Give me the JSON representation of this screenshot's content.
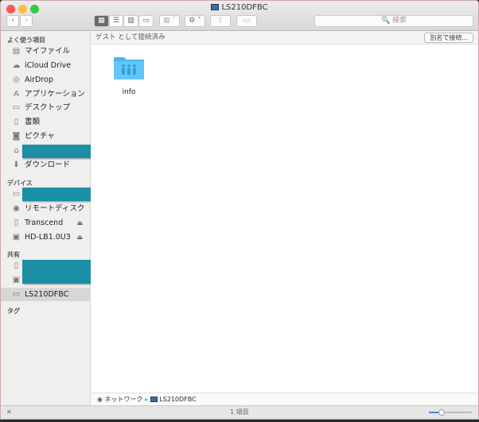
{
  "window": {
    "title": "LS210DFBC"
  },
  "toolbar": {
    "back": "‹",
    "forward": "›",
    "search_placeholder": "🔍 検索"
  },
  "sidebar": {
    "favorites_label": "よく使う項目",
    "favorites": [
      {
        "label": "マイファイル",
        "icon": "all-files-icon"
      },
      {
        "label": "iCloud Drive",
        "icon": "cloud-icon"
      },
      {
        "label": "AirDrop",
        "icon": "airdrop-icon"
      },
      {
        "label": "アプリケーション",
        "icon": "applications-icon"
      },
      {
        "label": "デスクトップ",
        "icon": "desktop-icon"
      },
      {
        "label": "書類",
        "icon": "documents-icon"
      },
      {
        "label": "ピクチャ",
        "icon": "camera-icon"
      },
      {
        "label": "",
        "icon": "home-icon"
      },
      {
        "label": "ダウンロード",
        "icon": "download-icon"
      }
    ],
    "devices_label": "デバイス",
    "devices": [
      {
        "label": "",
        "icon": "laptop-icon"
      },
      {
        "label": "リモートディスク",
        "icon": "disc-icon"
      },
      {
        "label": "Transcend",
        "icon": "drive-icon",
        "eject": "⏏"
      },
      {
        "label": "HD-LB1.0U3",
        "icon": "drive-icon",
        "eject": "⏏"
      }
    ],
    "shared_label": "共有",
    "shared": [
      {
        "label": "",
        "icon": "phone-icon"
      },
      {
        "label": "",
        "icon": "monitor-icon"
      },
      {
        "label": "LS210DFBC",
        "icon": "monitor-icon"
      }
    ],
    "tags_label": "タグ"
  },
  "main": {
    "connection_status": "ゲスト として接続済み",
    "connect_as_button": "別名で接続...",
    "items": [
      {
        "name": "info"
      }
    ]
  },
  "pathbar": {
    "network": "ネットワーク",
    "separator": "▸",
    "server": "LS210DFBC"
  },
  "statusbar": {
    "count": "1 項目",
    "close": "✕",
    "zoom_level": 0.3
  }
}
